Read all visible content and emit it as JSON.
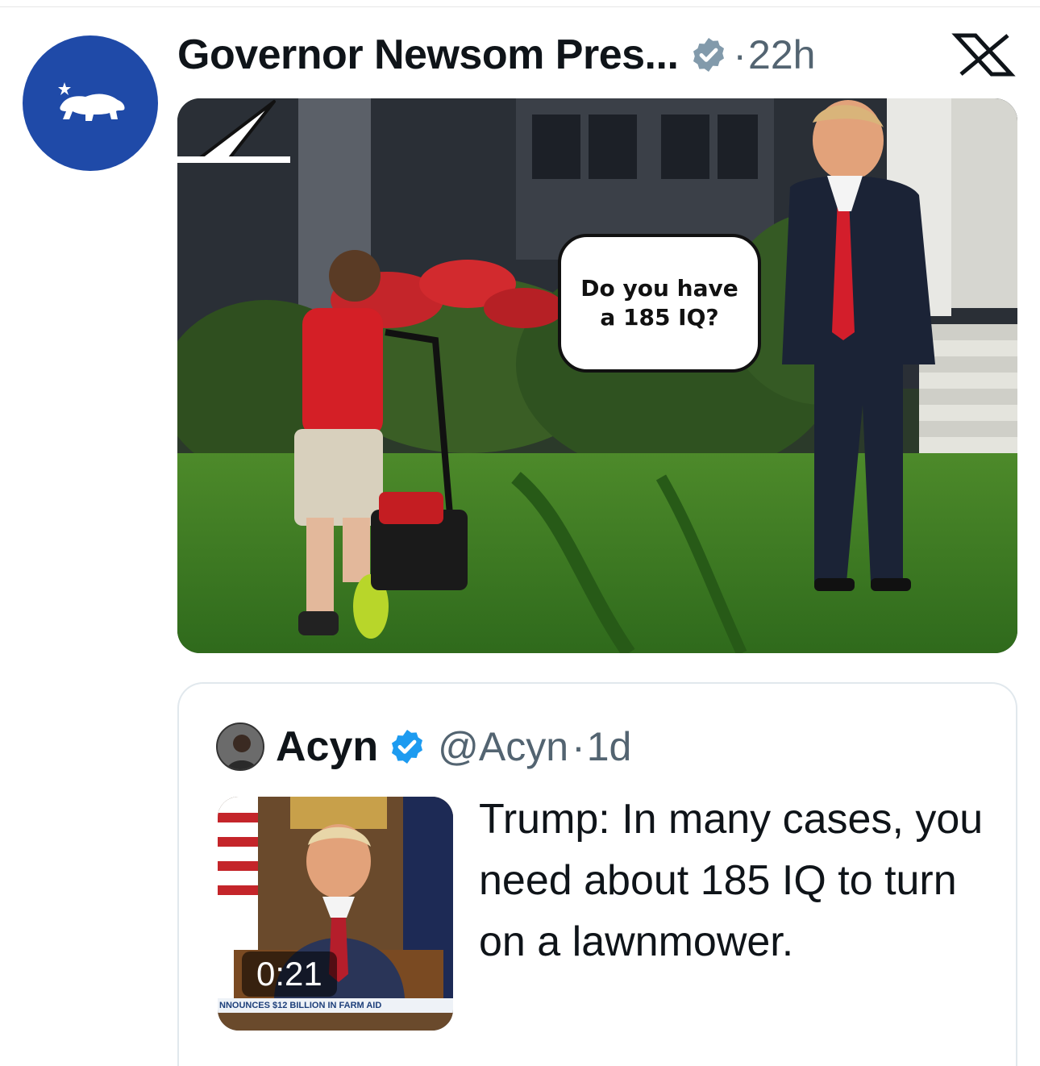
{
  "post": {
    "display_name": "Governor Newsom Pres...",
    "verified": "verified-gray-badge",
    "separator": "·",
    "timestamp": "22h",
    "platform_icon": "x-logo-icon",
    "media": {
      "speech_bubble_line1": "Do you have",
      "speech_bubble_line2": "a 185 IQ?"
    }
  },
  "quoted_post": {
    "display_name": "Acyn",
    "verified": "verified-blue-badge",
    "handle": "@Acyn",
    "separator": "·",
    "timestamp": "1d",
    "video_duration": "0:21",
    "video_chyron": "NNOUNCES $12 BILLION IN FARM AID",
    "text": "Trump: In many cases, you need about 185 IQ to turn on a lawnmower."
  },
  "colors": {
    "avatar_bg": "#1f4aa8",
    "verified_blue": "#1d9bf0",
    "verified_gray": "#829aab",
    "secondary_text": "#536471"
  }
}
